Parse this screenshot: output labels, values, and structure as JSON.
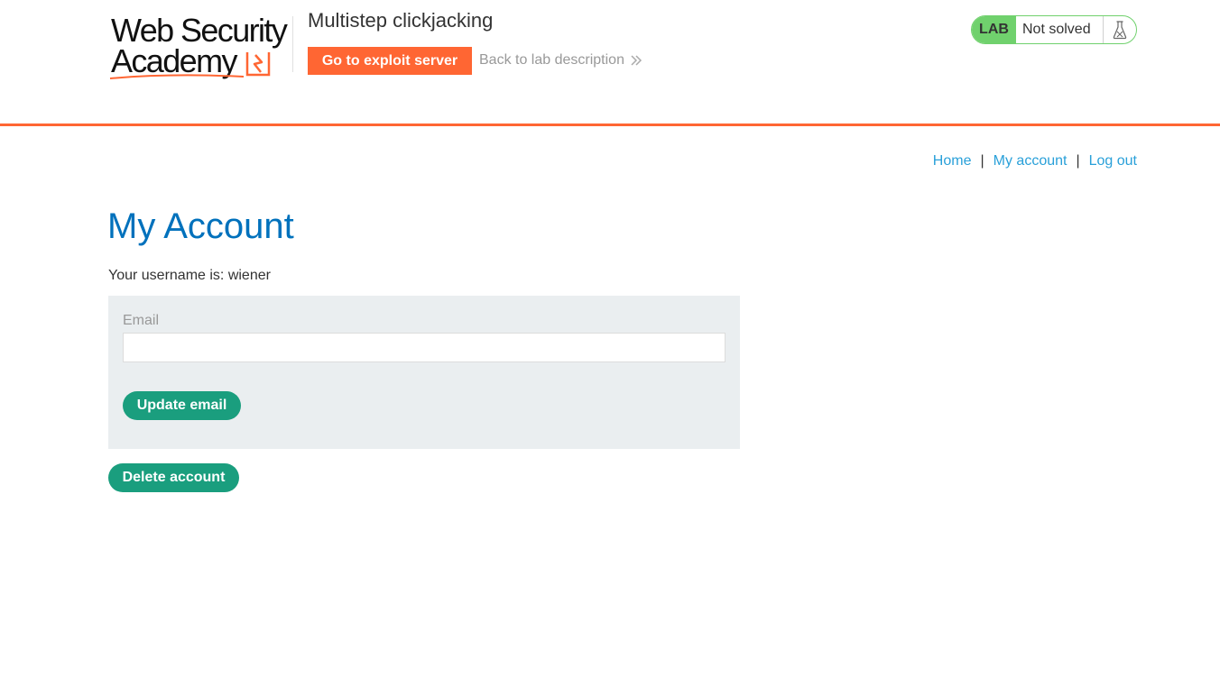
{
  "header": {
    "logo": {
      "line1": "Web Security",
      "line2": "Academy"
    },
    "lab_title": "Multistep clickjacking",
    "exploit_button_label": "Go to exploit server",
    "back_link_label": "Back to lab description",
    "lab_status": {
      "badge": "LAB",
      "status": "Not solved",
      "icon": "flask-icon"
    }
  },
  "nav": {
    "links": [
      {
        "label": "Home"
      },
      {
        "label": "My account"
      },
      {
        "label": "Log out"
      }
    ],
    "separator": "|"
  },
  "main": {
    "title": "My Account",
    "username_line": "Your username is: wiener",
    "email_form": {
      "label": "Email",
      "value": "",
      "submit_label": "Update email"
    },
    "delete_button_label": "Delete account"
  },
  "colors": {
    "accent_orange": "#ff6633",
    "title_blue": "#0071bc",
    "link_blue": "#29a0d9",
    "button_green": "#1a9e7e",
    "lab_green": "#70d16d",
    "form_bg": "#eaeef0"
  }
}
